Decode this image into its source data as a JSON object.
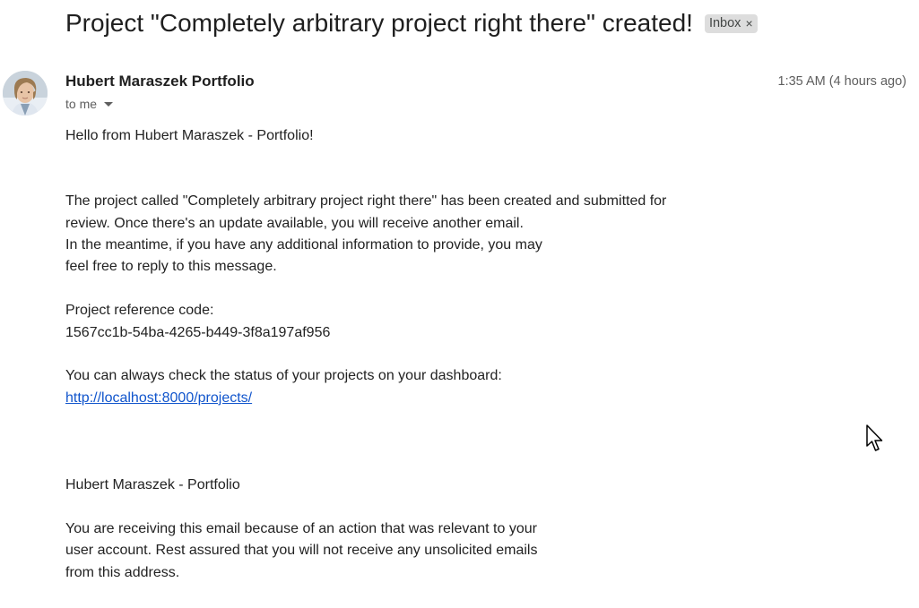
{
  "subject": "Project \"Completely arbitrary project right there\" created!",
  "label": {
    "name": "Inbox",
    "remove_glyph": "×"
  },
  "sender": {
    "name": "Hubert Maraszek Portfolio",
    "recipient": "to me",
    "avatar_icon": "user-avatar-photo"
  },
  "timestamp": "1:35 AM (4 hours ago)",
  "email_body": {
    "greeting": "Hello from Hubert Maraszek - Portfolio!",
    "para1_line1": "The project called \"Completely arbitrary project right there\" has been created and submitted for",
    "para1_line2": "review. Once there's an update available, you will receive another email.",
    "para1_line3": "In the meantime, if you have any additional information to provide, you may",
    "para1_line4": "feel free to reply to this message.",
    "ref_label": "Project reference code:",
    "ref_code": "1567cc1b-54ba-4265-b449-3f8a197af956",
    "dashboard_text": "You can always check the status of your projects on your dashboard:",
    "dashboard_link": "http://localhost:8000/projects/",
    "signature": "Hubert Maraszek - Portfolio",
    "footer_line1": "You are receiving this email because of an action that was relevant to your",
    "footer_line2": "user account. Rest assured that you will not receive any unsolicited emails",
    "footer_line3": "from this address."
  },
  "colors": {
    "link": "#1155cc",
    "chip_bg": "#dddddd",
    "muted_text": "#5e5e5e"
  },
  "cursor_icon": "mouse-pointer-icon"
}
